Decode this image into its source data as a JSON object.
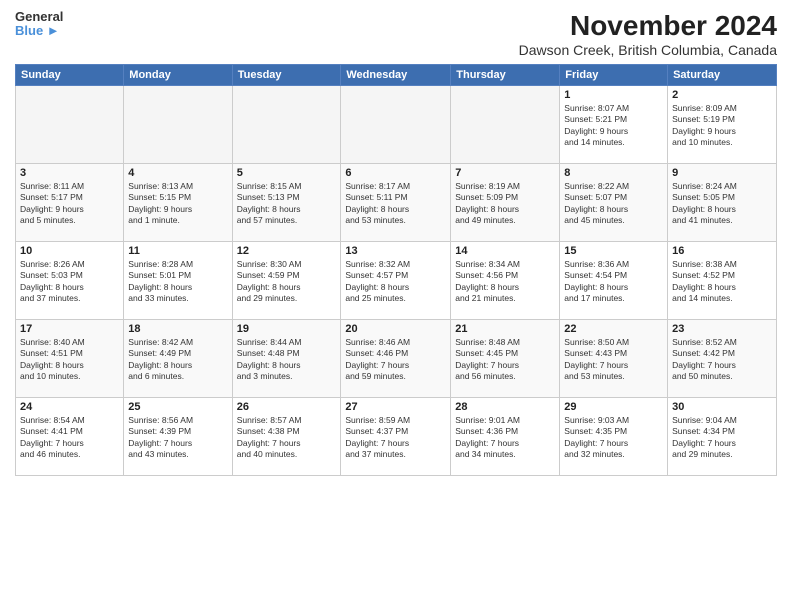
{
  "header": {
    "logo_line1": "General",
    "logo_line2": "Blue",
    "month": "November 2024",
    "location": "Dawson Creek, British Columbia, Canada"
  },
  "weekdays": [
    "Sunday",
    "Monday",
    "Tuesday",
    "Wednesday",
    "Thursday",
    "Friday",
    "Saturday"
  ],
  "weeks": [
    [
      {
        "day": "",
        "info": ""
      },
      {
        "day": "",
        "info": ""
      },
      {
        "day": "",
        "info": ""
      },
      {
        "day": "",
        "info": ""
      },
      {
        "day": "",
        "info": ""
      },
      {
        "day": "1",
        "info": "Sunrise: 8:07 AM\nSunset: 5:21 PM\nDaylight: 9 hours\nand 14 minutes."
      },
      {
        "day": "2",
        "info": "Sunrise: 8:09 AM\nSunset: 5:19 PM\nDaylight: 9 hours\nand 10 minutes."
      }
    ],
    [
      {
        "day": "3",
        "info": "Sunrise: 8:11 AM\nSunset: 5:17 PM\nDaylight: 9 hours\nand 5 minutes."
      },
      {
        "day": "4",
        "info": "Sunrise: 8:13 AM\nSunset: 5:15 PM\nDaylight: 9 hours\nand 1 minute."
      },
      {
        "day": "5",
        "info": "Sunrise: 8:15 AM\nSunset: 5:13 PM\nDaylight: 8 hours\nand 57 minutes."
      },
      {
        "day": "6",
        "info": "Sunrise: 8:17 AM\nSunset: 5:11 PM\nDaylight: 8 hours\nand 53 minutes."
      },
      {
        "day": "7",
        "info": "Sunrise: 8:19 AM\nSunset: 5:09 PM\nDaylight: 8 hours\nand 49 minutes."
      },
      {
        "day": "8",
        "info": "Sunrise: 8:22 AM\nSunset: 5:07 PM\nDaylight: 8 hours\nand 45 minutes."
      },
      {
        "day": "9",
        "info": "Sunrise: 8:24 AM\nSunset: 5:05 PM\nDaylight: 8 hours\nand 41 minutes."
      }
    ],
    [
      {
        "day": "10",
        "info": "Sunrise: 8:26 AM\nSunset: 5:03 PM\nDaylight: 8 hours\nand 37 minutes."
      },
      {
        "day": "11",
        "info": "Sunrise: 8:28 AM\nSunset: 5:01 PM\nDaylight: 8 hours\nand 33 minutes."
      },
      {
        "day": "12",
        "info": "Sunrise: 8:30 AM\nSunset: 4:59 PM\nDaylight: 8 hours\nand 29 minutes."
      },
      {
        "day": "13",
        "info": "Sunrise: 8:32 AM\nSunset: 4:57 PM\nDaylight: 8 hours\nand 25 minutes."
      },
      {
        "day": "14",
        "info": "Sunrise: 8:34 AM\nSunset: 4:56 PM\nDaylight: 8 hours\nand 21 minutes."
      },
      {
        "day": "15",
        "info": "Sunrise: 8:36 AM\nSunset: 4:54 PM\nDaylight: 8 hours\nand 17 minutes."
      },
      {
        "day": "16",
        "info": "Sunrise: 8:38 AM\nSunset: 4:52 PM\nDaylight: 8 hours\nand 14 minutes."
      }
    ],
    [
      {
        "day": "17",
        "info": "Sunrise: 8:40 AM\nSunset: 4:51 PM\nDaylight: 8 hours\nand 10 minutes."
      },
      {
        "day": "18",
        "info": "Sunrise: 8:42 AM\nSunset: 4:49 PM\nDaylight: 8 hours\nand 6 minutes."
      },
      {
        "day": "19",
        "info": "Sunrise: 8:44 AM\nSunset: 4:48 PM\nDaylight: 8 hours\nand 3 minutes."
      },
      {
        "day": "20",
        "info": "Sunrise: 8:46 AM\nSunset: 4:46 PM\nDaylight: 7 hours\nand 59 minutes."
      },
      {
        "day": "21",
        "info": "Sunrise: 8:48 AM\nSunset: 4:45 PM\nDaylight: 7 hours\nand 56 minutes."
      },
      {
        "day": "22",
        "info": "Sunrise: 8:50 AM\nSunset: 4:43 PM\nDaylight: 7 hours\nand 53 minutes."
      },
      {
        "day": "23",
        "info": "Sunrise: 8:52 AM\nSunset: 4:42 PM\nDaylight: 7 hours\nand 50 minutes."
      }
    ],
    [
      {
        "day": "24",
        "info": "Sunrise: 8:54 AM\nSunset: 4:41 PM\nDaylight: 7 hours\nand 46 minutes."
      },
      {
        "day": "25",
        "info": "Sunrise: 8:56 AM\nSunset: 4:39 PM\nDaylight: 7 hours\nand 43 minutes."
      },
      {
        "day": "26",
        "info": "Sunrise: 8:57 AM\nSunset: 4:38 PM\nDaylight: 7 hours\nand 40 minutes."
      },
      {
        "day": "27",
        "info": "Sunrise: 8:59 AM\nSunset: 4:37 PM\nDaylight: 7 hours\nand 37 minutes."
      },
      {
        "day": "28",
        "info": "Sunrise: 9:01 AM\nSunset: 4:36 PM\nDaylight: 7 hours\nand 34 minutes."
      },
      {
        "day": "29",
        "info": "Sunrise: 9:03 AM\nSunset: 4:35 PM\nDaylight: 7 hours\nand 32 minutes."
      },
      {
        "day": "30",
        "info": "Sunrise: 9:04 AM\nSunset: 4:34 PM\nDaylight: 7 hours\nand 29 minutes."
      }
    ]
  ]
}
